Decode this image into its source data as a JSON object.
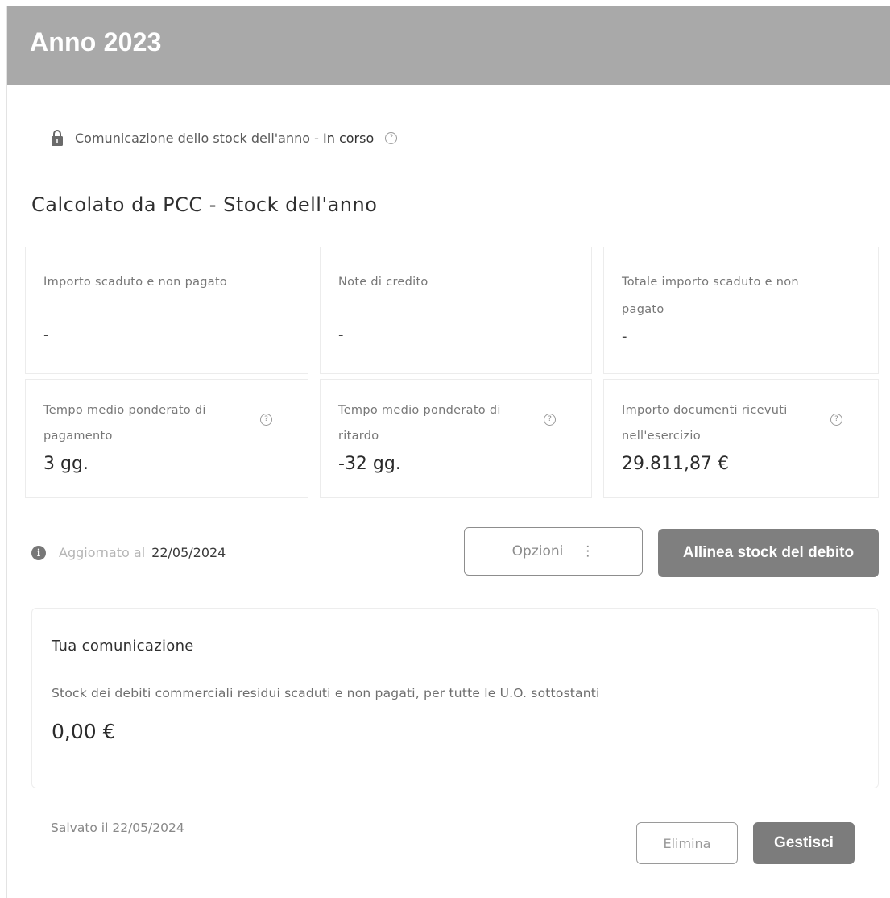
{
  "header": {
    "title": "Anno 2023"
  },
  "status": {
    "prefix": "Comunicazione dello stock dell'anno - ",
    "state": "In corso",
    "icon": "lock-icon",
    "help_icon": "help-icon"
  },
  "section": {
    "title": "Calcolato da PCC - Stock dell'anno"
  },
  "cards": [
    {
      "label": "Importo scaduto e non pagato",
      "value": "-"
    },
    {
      "label": "Note di credito",
      "value": "-"
    },
    {
      "label": "Totale importo scaduto e non pagato",
      "value": "-"
    },
    {
      "label": "Tempo medio ponderato di pagamento",
      "value": "3 gg."
    },
    {
      "label": "Tempo medio ponderato di ritardo",
      "value": "-32 gg."
    },
    {
      "label": "Importo documenti ricevuti nell'esercizio",
      "value": "29.811,87 €"
    }
  ],
  "update": {
    "label": "Aggiornato al",
    "date": "22/05/2024",
    "icon": "info-icon"
  },
  "actions": {
    "options_label": "Opzioni",
    "options_icon": "⋮",
    "align_label": "Allinea stock del debito"
  },
  "communication": {
    "title": "Tua comunicazione",
    "description": "Stock dei debiti commerciali residui scaduti e non pagati, per tutte le U.O. sottostanti",
    "value": "0,00 €"
  },
  "footer": {
    "saved_label": "Salvato il 22/05/2024",
    "delete_label": "Elimina",
    "manage_label": "Gestisci"
  },
  "colors": {
    "header_bg": "#a9a9a9",
    "primary_button": "#7f7f7f"
  }
}
